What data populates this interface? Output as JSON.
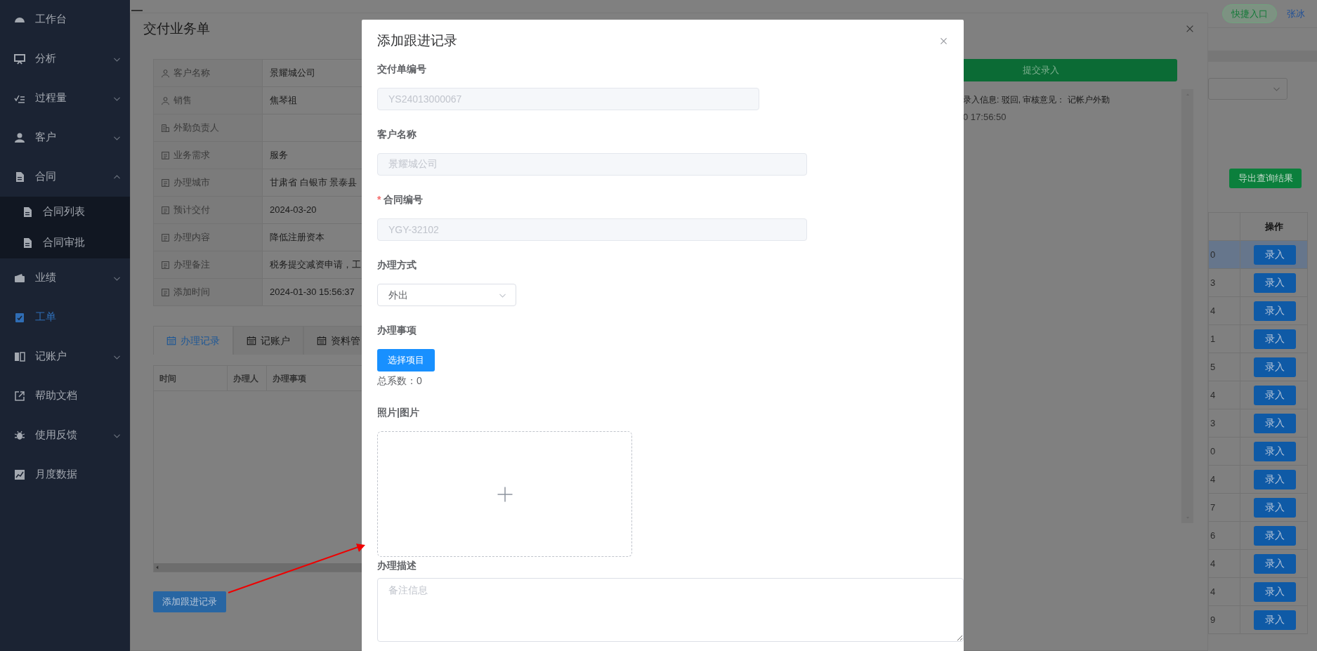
{
  "sidebar": {
    "items": [
      {
        "label": "工作台",
        "selected": false
      },
      {
        "label": "分析",
        "selected": false,
        "expanded": false
      },
      {
        "label": "过程量",
        "selected": false,
        "expanded": false
      },
      {
        "label": "客户",
        "selected": false,
        "expanded": false
      },
      {
        "label": "合同",
        "selected": false,
        "expanded": true,
        "children": [
          {
            "label": "合同列表",
            "selected": false
          },
          {
            "label": "合同审批",
            "selected": false
          }
        ]
      },
      {
        "label": "业绩",
        "selected": false,
        "expanded": false
      },
      {
        "label": "工单",
        "selected": true
      },
      {
        "label": "记账户",
        "selected": false,
        "expanded": false
      },
      {
        "label": "帮助文档",
        "selected": false
      },
      {
        "label": "使用反馈",
        "selected": false,
        "expanded": false
      },
      {
        "label": "月度数据",
        "selected": false
      }
    ]
  },
  "header": {
    "quick_entry": "快捷入口",
    "user": "张冰"
  },
  "background_page": {
    "export_button": "导出查询结果",
    "table": {
      "columns": [
        "操作"
      ],
      "rows": [
        {
          "column_1": "0",
          "action": "录入",
          "selected": true
        },
        {
          "column_1": "3",
          "action": "录入",
          "selected": false
        },
        {
          "column_1": "4",
          "action": "录入",
          "selected": false
        },
        {
          "column_1": "1",
          "action": "录入",
          "selected": false
        },
        {
          "column_1": "5",
          "action": "录入",
          "selected": false
        },
        {
          "column_1": "4",
          "action": "录入",
          "selected": false
        },
        {
          "column_1": "3",
          "action": "录入",
          "selected": false
        },
        {
          "column_1": "0",
          "action": "录入",
          "selected": false
        },
        {
          "column_1": "4",
          "action": "录入",
          "selected": false
        },
        {
          "column_1": "7",
          "action": "录入",
          "selected": false
        },
        {
          "column_1": "6",
          "action": "录入",
          "selected": false
        },
        {
          "column_1": "4",
          "action": "录入",
          "selected": false
        },
        {
          "column_1": "4",
          "action": "录入",
          "selected": false
        },
        {
          "column_1": "9",
          "action": "录入",
          "selected": false
        }
      ]
    }
  },
  "drawer": {
    "title": "交付业务单",
    "details": [
      {
        "label": "客户名称",
        "value": "景耀城公司"
      },
      {
        "label": "销售",
        "value": "焦琴祖"
      },
      {
        "label": "外勤负责人"
      },
      {
        "label": "业务需求",
        "value": "服务"
      },
      {
        "label": "办理城市",
        "value": "甘肃省 白银市 景泰县"
      },
      {
        "label": "预计交付",
        "value": "2024-03-20"
      },
      {
        "label": "办理内容",
        "value": "降低注册资本"
      },
      {
        "label": "办理备注",
        "value": "税务提交减资申请，工"
      },
      {
        "label": "添加时间",
        "value": "2024-01-30 15:56:37"
      }
    ],
    "tabs": [
      {
        "label": "办理记录",
        "selected": true
      },
      {
        "label": "记账户",
        "selected": false
      },
      {
        "label": "资料管",
        "selected": false
      }
    ],
    "records_table": {
      "columns": [
        "时间",
        "办理人",
        "办理事项"
      ]
    },
    "add_button": "添加跟进记录",
    "submit_button": "提交录入",
    "log": [
      "录入信息: 驳回, 审核意见：  记帐户外勤",
      "0 17:56:50"
    ]
  },
  "modal": {
    "title": "添加跟进记录",
    "fields": [
      {
        "kind": "input",
        "label": "交付单编号",
        "value": "YS24013000067",
        "disabled": true
      },
      {
        "kind": "input",
        "label": "客户名称",
        "value": "景耀城公司",
        "disabled": true
      },
      {
        "kind": "input",
        "label": "合同编号",
        "value": "YGY-32102",
        "disabled": true,
        "required_mark": "*"
      },
      {
        "kind": "select",
        "label": "办理方式",
        "value": "外出"
      },
      {
        "kind": "picker",
        "label": "办理事项",
        "button": "选择项目",
        "count": "总系数：0"
      },
      {
        "kind": "upload",
        "label": "照片|图片"
      },
      {
        "kind": "textarea",
        "label": "办理描述",
        "placeholder": "备注信息"
      }
    ]
  }
}
